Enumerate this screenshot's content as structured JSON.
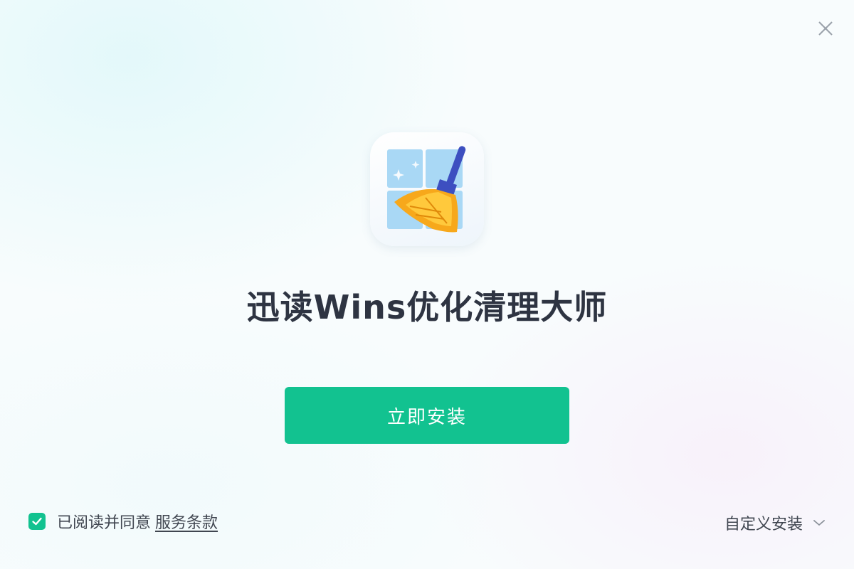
{
  "window": {
    "close_icon": "close-icon"
  },
  "app": {
    "icon": "broom-window-icon",
    "title": "迅读Wins优化清理大师"
  },
  "install_button": {
    "label": "立即安装"
  },
  "agreement": {
    "checked": true,
    "text": "已阅读并同意",
    "terms_link": "服务条款"
  },
  "custom_install": {
    "label": "自定义安装",
    "icon": "chevron-down-icon"
  },
  "colors": {
    "accent": "#12c290",
    "title_text": "#2e3442",
    "body_text": "#404650"
  }
}
